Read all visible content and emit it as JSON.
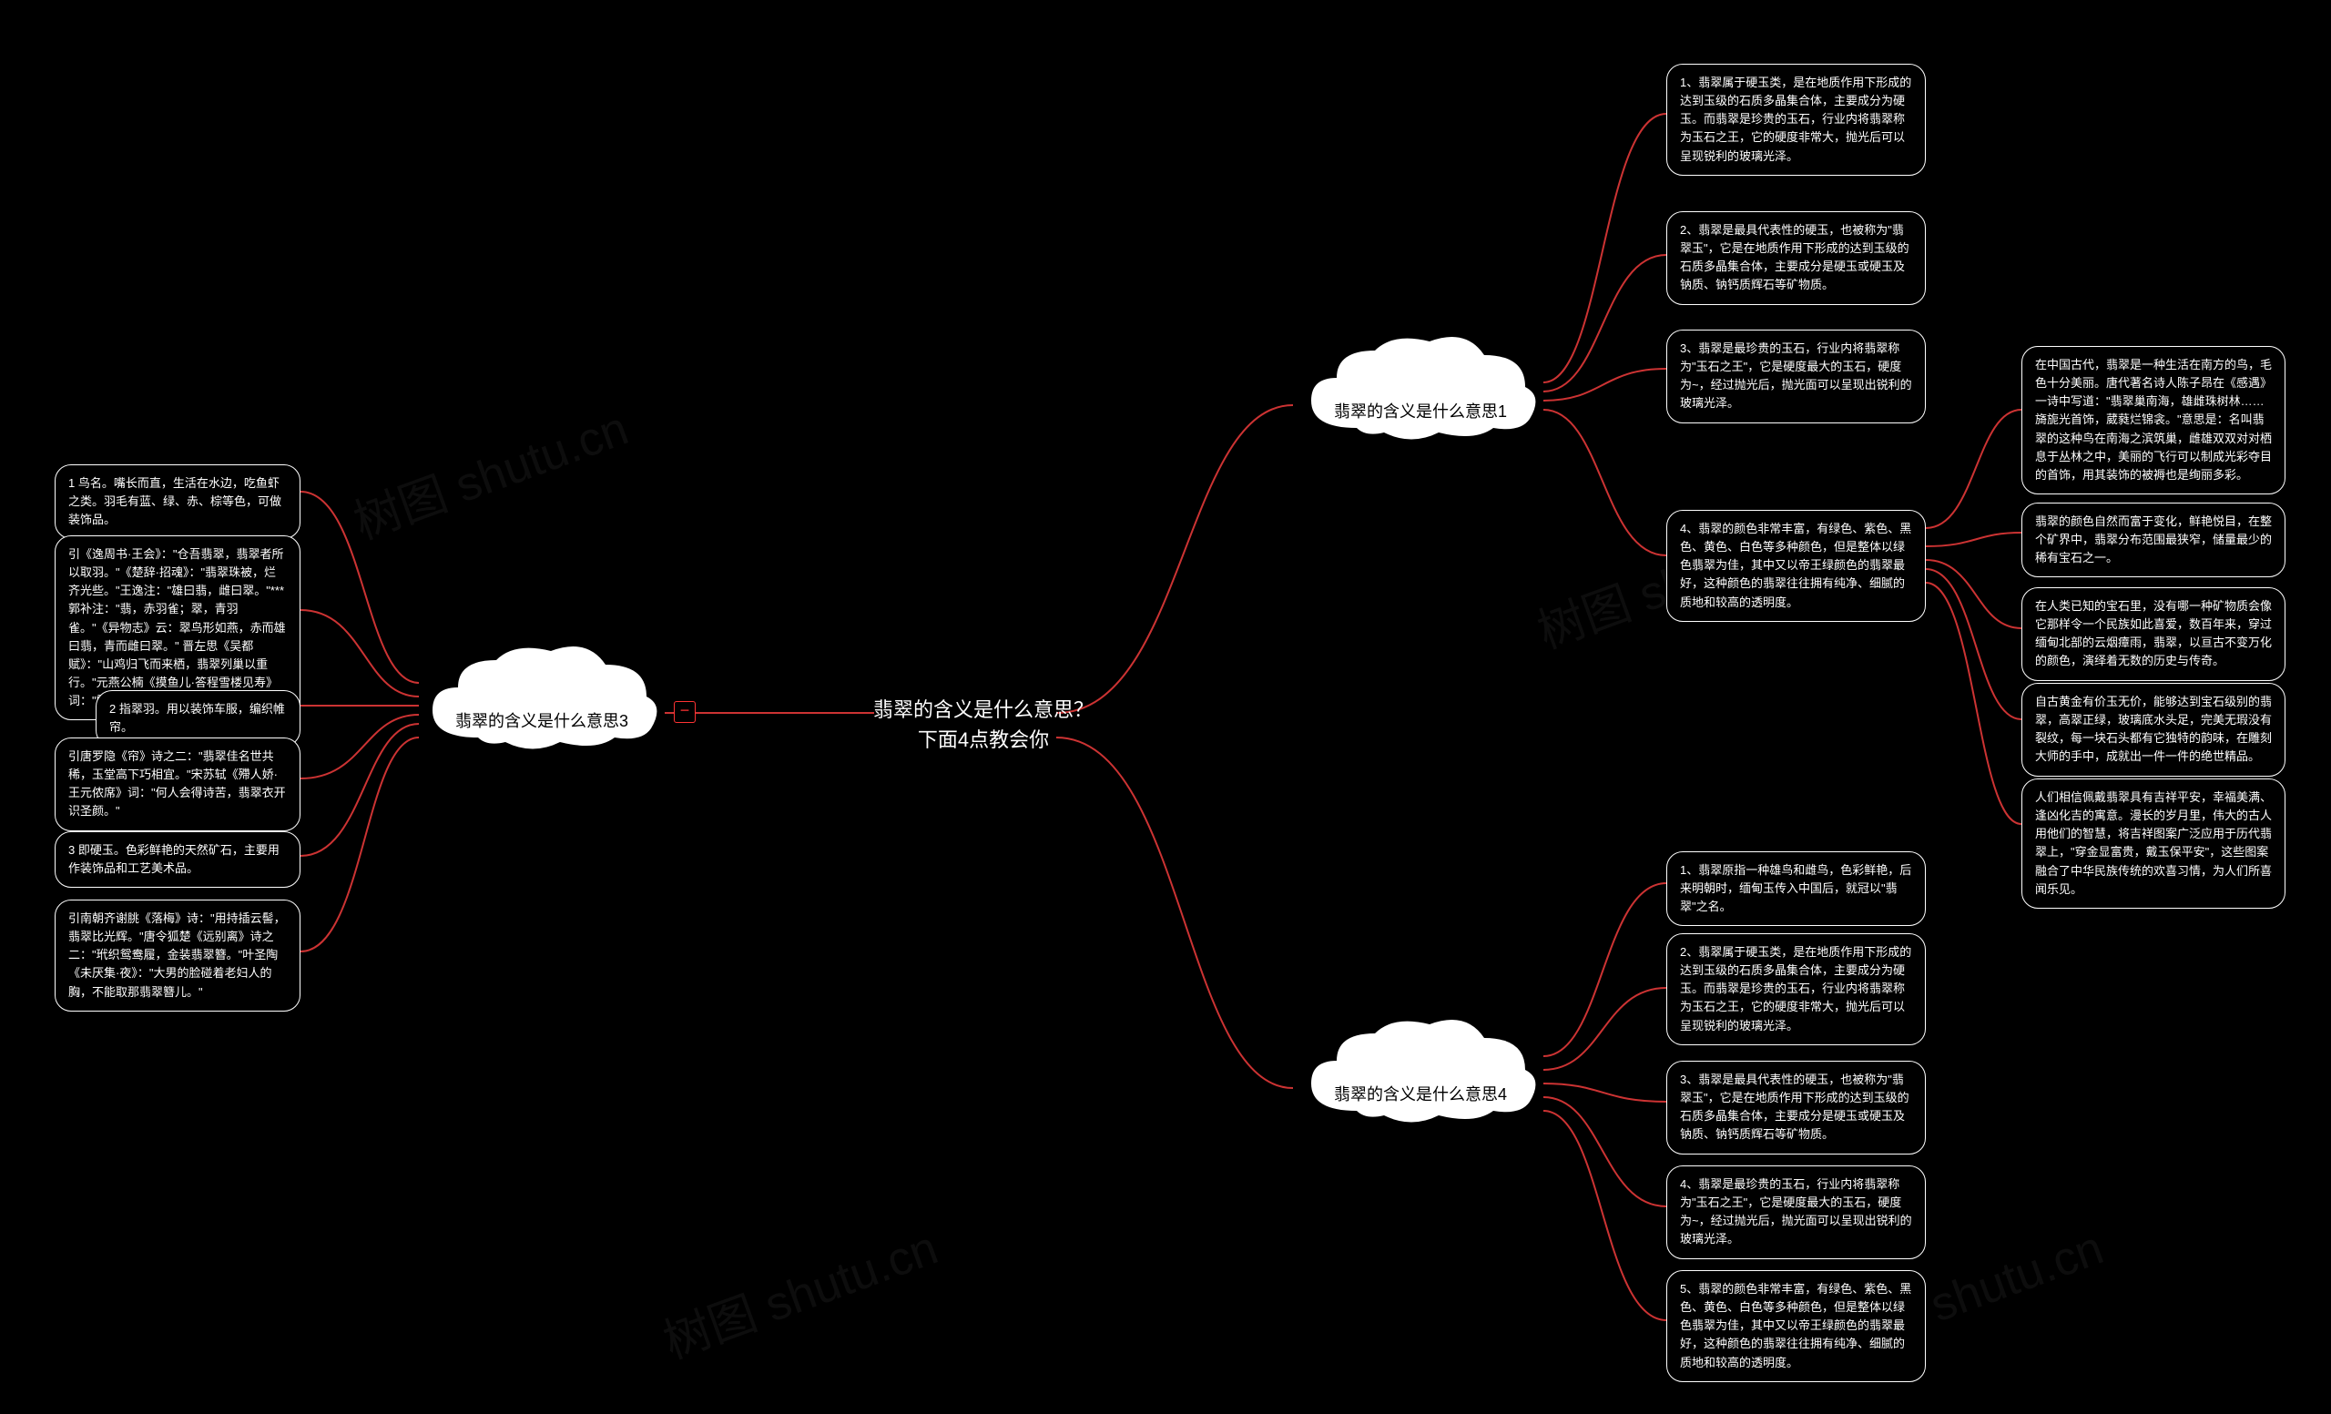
{
  "watermark": "树图 shutu.cn",
  "root": {
    "line1": "翡翠的含义是什么意思？",
    "line2": "下面4点教会你"
  },
  "branch1": {
    "label": "翡翠的含义是什么意思1",
    "children": [
      "1、翡翠属于硬玉类，是在地质作用下形成的达到玉级的石质多晶集合体，主要成分为硬玉。而翡翠是珍贵的玉石，行业内将翡翠称为玉石之王，它的硬度非常大，抛光后可以呈现锐利的玻璃光泽。",
      "2、翡翠是最具代表性的硬玉，也被称为\"翡翠玉\"，它是在地质作用下形成的达到玉级的石质多晶集合体，主要成分是硬玉或硬玉及钠质、钠钙质辉石等矿物质。",
      "3、翡翠是最珍贵的玉石，行业内将翡翠称为\"玉石之王\"，它是硬度最大的玉石，硬度为~，经过抛光后，抛光面可以呈现出锐利的玻璃光泽。",
      "4、翡翠的颜色非常丰富，有绿色、紫色、黑色、黄色、白色等多种颜色，但是整体以绿色翡翠为佳，其中又以帝王绿颜色的翡翠最好，这种颜色的翡翠往往拥有纯净、细腻的质地和较高的透明度。"
    ],
    "grandChildren": [
      "在中国古代，翡翠是一种生活在南方的鸟，毛色十分美丽。唐代著名诗人陈子昂在《感遇》一诗中写道：\"翡翠巢南海，雄雌珠树林……旖旎光首饰，葳蕤烂锦衾。\"意思是：名叫翡翠的这种鸟在南海之滨筑巢，雌雄双双对对栖息于丛林之中，美丽的飞行可以制成光彩夺目的首饰，用其装饰的被褥也是绚丽多彩。",
      "翡翠的颜色自然而富于变化，鲜艳悦目，在整个矿界中，翡翠分布范围最狭窄，储量最少的稀有宝石之一。",
      "在人类已知的宝石里，没有哪一种矿物质会像它那样令一个民族如此喜爱，数百年来，穿过缅甸北部的云烟瘴雨，翡翠，以亘古不变万化的颜色，演绎着无数的历史与传奇。",
      "自古黄金有价玉无价，能够达到宝石级别的翡翠，高翠正绿，玻璃底水头足，完美无瑕没有裂纹，每一块石头都有它独特的韵味，在雕刻大师的手中，成就出一件一件的绝世精品。",
      "人们相信佩戴翡翠具有吉祥平安，幸福美满、逢凶化吉的寓意。漫长的岁月里，伟大的古人用他们的智慧，将吉祥图案广泛应用于历代翡翠上，\"穿金显富贵，戴玉保平安\"，这些图案融合了中华民族传统的欢喜习情，为人们所喜闻乐见。"
    ]
  },
  "branch3": {
    "label": "翡翠的含义是什么意思3",
    "children": [
      "1 鸟名。嘴长而直，生活在水边，吃鱼虾之类。羽毛有蓝、绿、赤、棕等色，可做装饰品。",
      "引《逸周书·王会》：\"仓吾翡翠，翡翠者所以取羽。\"《楚辞·招魂》：\"翡翠珠被，烂齐光些。\"王逸注：\"雄曰翡，雌曰翠。\"***郭补注：\"翡，赤羽雀；翠，青羽雀。\"《异物志》云：翠鸟形如燕，赤而雄曰翡，青而雌曰翠。\" 晋左思《吴都赋》：\"山鸡归飞而来栖，翡翠列巢以重行。\"元燕公楠《摸鱼儿·答程雪楼见寿》词：\"霜鬓缕，只梦听枝头翡翠催归去。\"",
      "2 指翠羽。用以装饰车服，编织帷帘。",
      "引唐罗隐《帘》诗之二：\"翡翠佳名世共稀，玉堂高下巧相宜。\"宋苏轼《殢人娇·王元侬席》词：\"何人会得诗苦，翡翠衣开识圣颜。\"",
      "3 即硬玉。色彩鲜艳的天然矿石，主要用作装饰品和工艺美术品。",
      "引南朝齐谢朓《落梅》诗：\"用持插云髻，翡翠比光辉。\"唐令狐楚《远别离》诗之二：\"玳织鸳鸯履，金装翡翠簪。\"叶圣陶《未厌集·夜》：\"大男的脸碰着老妇人的胸，不能取那翡翠簪儿。\""
    ]
  },
  "branch4": {
    "label": "翡翠的含义是什么意思4",
    "children": [
      "1、翡翠原指一种雄鸟和雌鸟，色彩鲜艳，后来明朝时，缅甸玉传入中国后，就冠以\"翡翠\"之名。",
      "2、翡翠属于硬玉类，是在地质作用下形成的达到玉级的石质多晶集合体，主要成分为硬玉。而翡翠是珍贵的玉石，行业内将翡翠称为玉石之王，它的硬度非常大，抛光后可以呈现锐利的玻璃光泽。",
      "3、翡翠是最具代表性的硬玉，也被称为\"翡翠玉\"，它是在地质作用下形成的达到玉级的石质多晶集合体，主要成分是硬玉或硬玉及钠质、钠钙质辉石等矿物质。",
      "4、翡翠是最珍贵的玉石，行业内将翡翠称为\"玉石之王\"，它是硬度最大的玉石，硬度为~，经过抛光后，抛光面可以呈现出锐利的玻璃光泽。",
      "5、翡翠的颜色非常丰富，有绿色、紫色、黑色、黄色、白色等多种颜色，但是整体以绿色翡翠为佳，其中又以帝王绿颜色的翡翠最好，这种颜色的翡翠往往拥有纯净、细腻的质地和较高的透明度。"
    ]
  },
  "collapseSymbol": "−",
  "chart_data": {
    "type": "mindmap",
    "root": "翡翠的含义是什么意思？下面4点教会你",
    "branches": [
      {
        "side": "right",
        "label": "翡翠的含义是什么意思1",
        "childCount": 4,
        "grandChildOfIndex": 3,
        "grandChildCount": 5
      },
      {
        "side": "left",
        "label": "翡翠的含义是什么意思3",
        "childCount": 6,
        "collapsed_hint": true
      },
      {
        "side": "right",
        "label": "翡翠的含义是什么意思4",
        "childCount": 5
      }
    ]
  }
}
